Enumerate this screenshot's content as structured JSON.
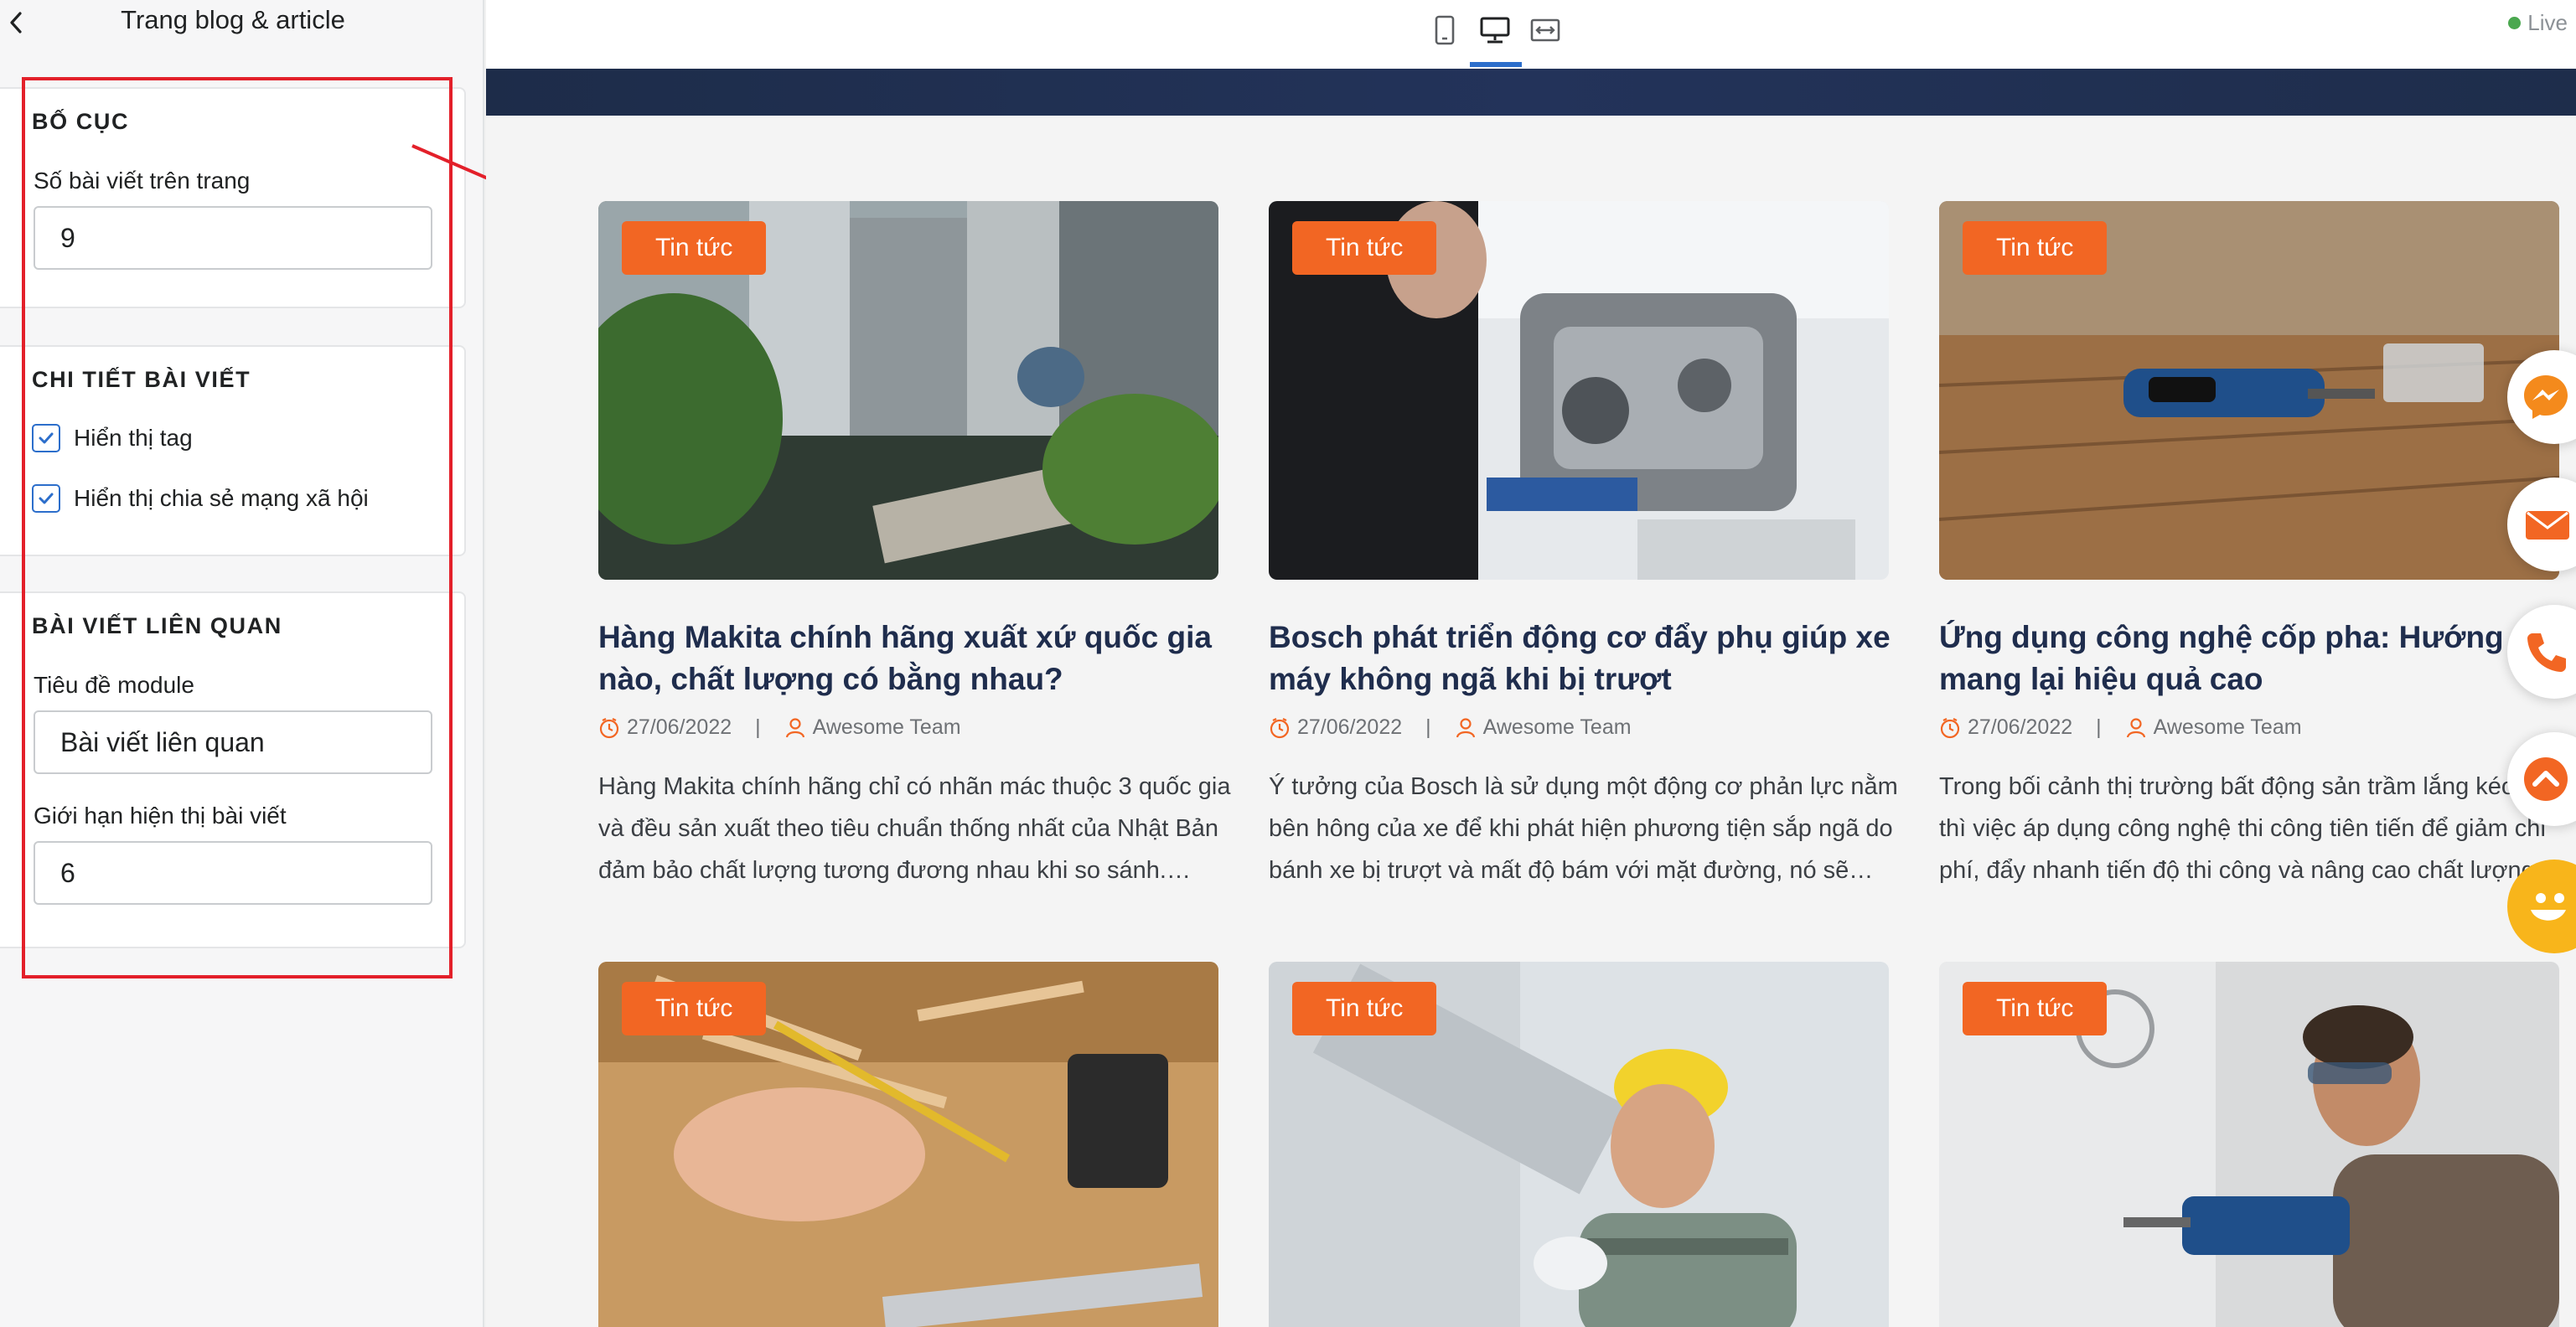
{
  "sidebar": {
    "title": "Trang blog & article",
    "layout_section": {
      "heading": "BỐ CỤC",
      "posts_per_page_label": "Số bài viết trên trang",
      "posts_per_page_value": "9"
    },
    "detail_section": {
      "heading": "CHI TIẾT BÀI VIẾT",
      "show_tag_label": "Hiển thị tag",
      "show_tag_checked": true,
      "show_share_label": "Hiển thị chia sẻ mạng xã hội",
      "show_share_checked": true
    },
    "related_section": {
      "heading": "BÀI VIẾT LIÊN QUAN",
      "module_title_label": "Tiêu đề module",
      "module_title_value": "Bài viết liên quan",
      "limit_label": "Giới hạn hiện thị bài viết",
      "limit_value": "6"
    }
  },
  "topbar": {
    "devices": [
      "mobile-icon",
      "desktop-icon",
      "full-width-icon"
    ],
    "active_device": "desktop-icon",
    "status": "Live",
    "status_color": "#4aa84f"
  },
  "articles": [
    {
      "tag": "Tin tức",
      "title_line1": "Hàng Makita chính hãng xuất xứ quốc gia",
      "title_line2": "nào, chất lượng có bằng nhau?",
      "date": "27/06/2022",
      "author": "Awesome Team",
      "excerpt_line1": "Hàng Makita chính hãng chỉ có nhãn mác thuộc 3 quốc gia",
      "excerpt_line2": "và đều sản xuất theo tiêu chuẩn thống nhất của Nhật Bản",
      "excerpt_line3": "đảm bảo chất lượng tương đương nhau khi so sánh.…"
    },
    {
      "tag": "Tin tức",
      "title_line1": "Bosch phát triển động cơ đẩy phụ giúp xe",
      "title_line2": "máy không ngã khi bị trượt",
      "date": "27/06/2022",
      "author": "Awesome Team",
      "excerpt_line1": "Ý tưởng của Bosch là sử dụng một động cơ phản lực nằm",
      "excerpt_line2": "bên hông của xe để khi phát hiện phương tiện sắp ngã do",
      "excerpt_line3": "bánh xe bị trượt và mất độ bám với mặt đường, nó sẽ…"
    },
    {
      "tag": "Tin tức",
      "title_line1": "Ứng dụng công nghệ cốp pha: Hướng đi",
      "title_line2": "mang lại hiệu quả cao",
      "date": "27/06/2022",
      "author": "Awesome Team",
      "excerpt_line1": "Trong bối cảnh thị trường bất động sản trầm lắng kéo",
      "excerpt_line2": "thì việc áp dụng công nghệ thi công tiên tiến để giảm chi",
      "excerpt_line3": "phí, đẩy nhanh tiến độ thi công và nâng cao chất lượng…"
    },
    {
      "tag": "Tin tức"
    },
    {
      "tag": "Tin tức"
    },
    {
      "tag": "Tin tức"
    }
  ],
  "floating_buttons": [
    "messenger-icon",
    "mail-icon",
    "phone-icon",
    "scroll-up-icon",
    "smiley-icon"
  ],
  "colors": {
    "accent_blue": "#2c6ecb",
    "tag_orange": "#f26623",
    "title_navy": "#1f2d4d",
    "highlight_red": "#e3202a",
    "messenger_orange": "#f48a1c",
    "smiley_yellow": "#f8b51b"
  }
}
